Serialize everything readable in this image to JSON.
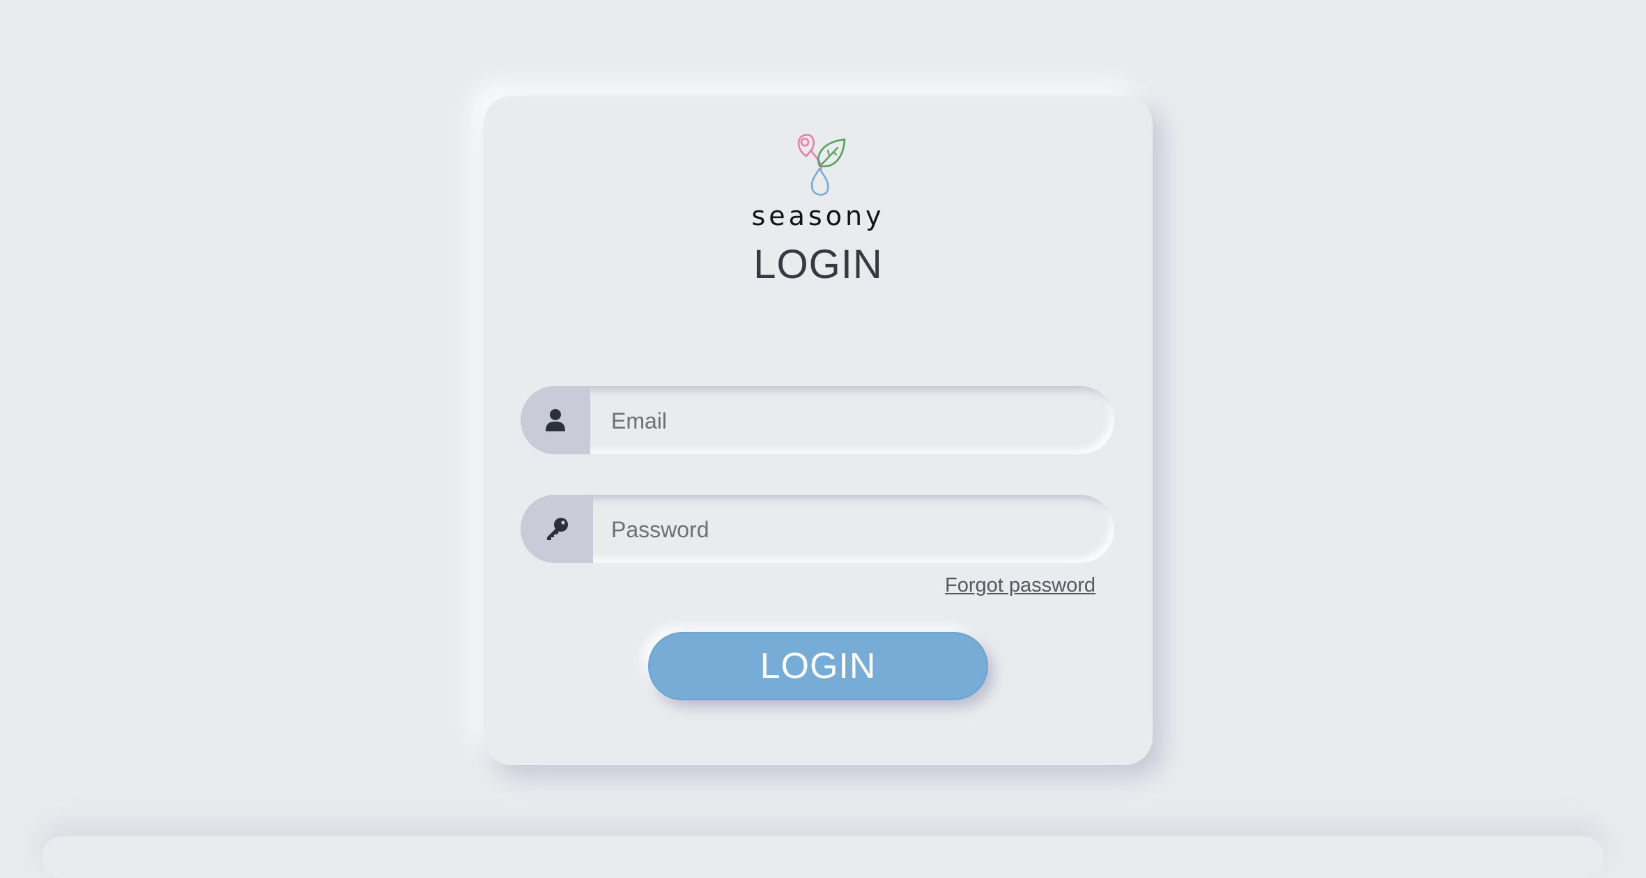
{
  "brand": {
    "name": "seasony",
    "logo_icon": "seasony-logo-icon",
    "colors": {
      "pin": "#e57fa8",
      "leaf": "#5aa05c",
      "drop": "#76acd6"
    }
  },
  "login": {
    "title": "LOGIN",
    "email": {
      "placeholder": "Email",
      "value": "",
      "icon": "user-icon"
    },
    "password": {
      "placeholder": "Password",
      "value": "",
      "icon": "key-icon"
    },
    "forgot_password_label": "Forgot password",
    "submit_label": "LOGIN"
  },
  "colors": {
    "background": "#eaebef",
    "accent": "#76acd6",
    "icon_box": "#c9ccd8",
    "text_dark": "#343a40"
  }
}
